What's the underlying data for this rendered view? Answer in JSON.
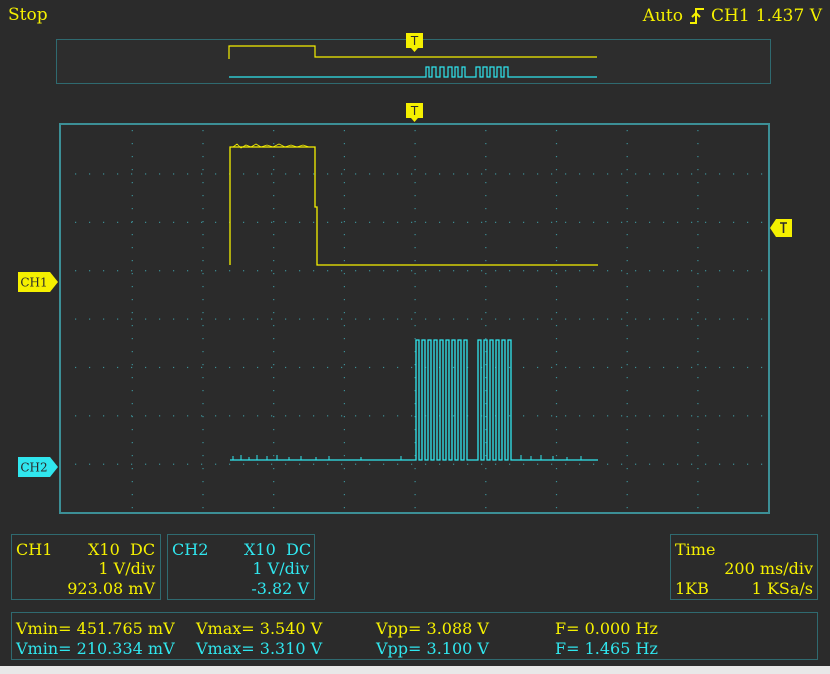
{
  "header": {
    "status": "Stop",
    "trigger_mode": "Auto",
    "trigger_channel": "CH1",
    "trigger_level": "1.437 V",
    "trigger_icon": "rising-edge-icon"
  },
  "markers": {
    "trigger_marker": "T",
    "ch1_label": "CH1",
    "ch2_label": "CH2"
  },
  "channels": {
    "ch1": {
      "name": "CH1",
      "probe": "X10",
      "coupling": "DC",
      "scale": "1 V/div",
      "offset": "923.08 mV"
    },
    "ch2": {
      "name": "CH2",
      "probe": "X10",
      "coupling": "DC",
      "scale": "1 V/div",
      "offset": "-3.82 V"
    }
  },
  "timebase": {
    "title": "Time",
    "scale": "200 ms/div",
    "memory": "1KB",
    "sample_rate": "1 KSa/s"
  },
  "measurements": {
    "ch1": {
      "vmin": "Vmin= 451.765 mV",
      "vmax": "Vmax= 3.540 V",
      "vpp": "Vpp= 3.088 V",
      "freq": "F= 0.000 Hz"
    },
    "ch2": {
      "vmin": "Vmin= 210.334 mV",
      "vmax": "Vmax= 3.310 V",
      "vpp": "Vpp= 3.100 V",
      "freq": "F= 1.465 Hz"
    }
  },
  "colors": {
    "ch1": "#f5f000",
    "ch2": "#30e6ee",
    "grid": "#3c8f96",
    "background": "#2b2b2b"
  }
}
